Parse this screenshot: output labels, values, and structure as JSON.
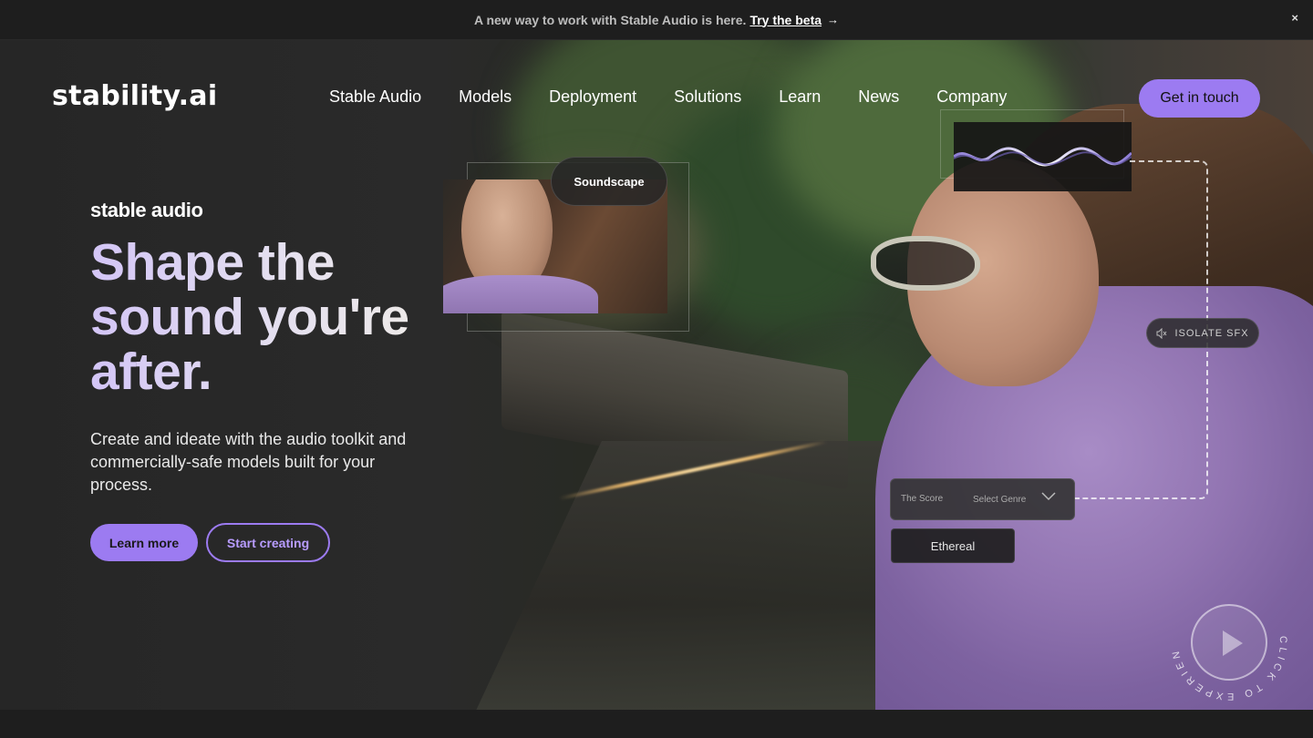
{
  "banner": {
    "message": "A new way to work with Stable Audio is here.",
    "link": "Try the beta",
    "arrow": "→",
    "close": "×"
  },
  "nav": {
    "logo": "stability.ai",
    "items": [
      "Stable Audio",
      "Models",
      "Deployment",
      "Solutions",
      "Learn",
      "News",
      "Company"
    ],
    "cta": "Get in touch"
  },
  "hero": {
    "brand": "stable audio",
    "headline": "Shape the sound you're after.",
    "subtitle": "Create and ideate with the audio toolkit and commercially-safe models built for your process.",
    "primary_button": "Learn more",
    "secondary_button": "Start creating"
  },
  "overlays": {
    "soundscape": "Soundscape",
    "isolate": "ISOLATE SFX",
    "score_label": "The Score",
    "genre_placeholder": "Select Genre",
    "genre_option": "Ethereal",
    "play_ring_text": "CLICK TO EXPERIENCE SOUND"
  },
  "colors": {
    "accent": "#9c7bf1",
    "background": "#262626"
  },
  "icons": {
    "close": "close-icon",
    "arrow": "arrow-right-icon",
    "mute": "speaker-muted-icon",
    "chevron": "chevron-down-icon",
    "play": "play-icon"
  }
}
